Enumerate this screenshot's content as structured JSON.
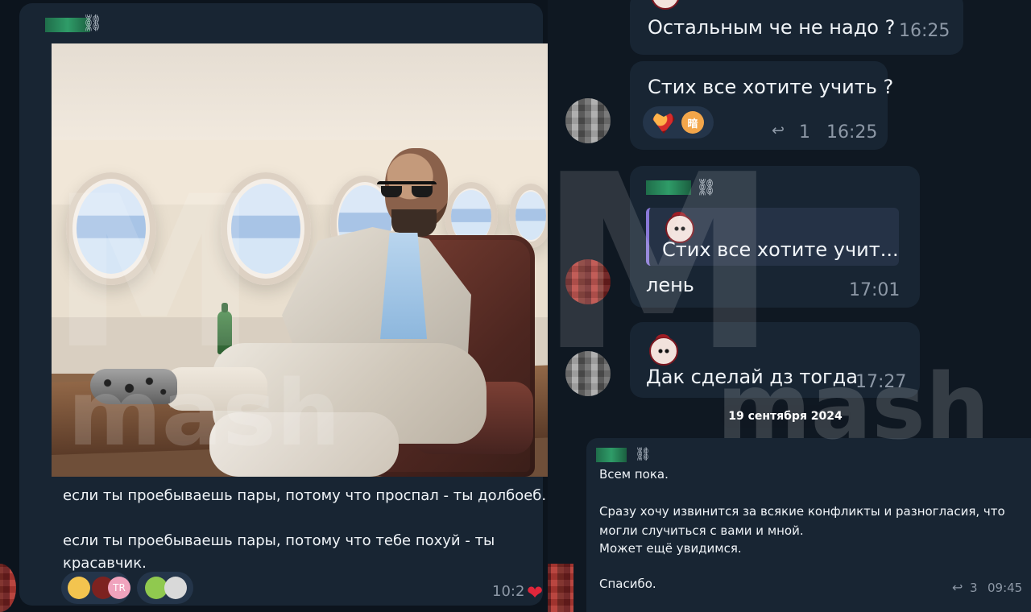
{
  "left": {
    "caption_lines": [
      "если ты проебываешь пары, потому что проспал - ты долбоеб.",
      "",
      "если ты проебываешь пары, потому что тебе похуй - ты",
      "красавчик."
    ],
    "time": "10:2",
    "reactions": [
      "thumbs-up",
      "devil",
      "tr-badge",
      "sick-face",
      "sticker"
    ],
    "tr_badge_text": "TR"
  },
  "right": {
    "messages": [
      {
        "text": "Остальным че не надо ?",
        "time": "16:25"
      },
      {
        "text": "Стих все хотите учить ?",
        "time": "16:25",
        "reply_count": "1",
        "reaction_badge": "暗"
      },
      {
        "reply_preview": "Стих все хотите учит...",
        "text": "лень",
        "time": "17:01"
      },
      {
        "text": "Дак сделай дз тогда",
        "time": "17:27"
      }
    ],
    "date_separator": "19 сентября 2024",
    "final_message": {
      "lines": [
        "Всем пока.",
        "",
        "Сразу хочу извинится за всякие конфликты и разногласия, что",
        "могли случиться с вами и мной.",
        "Может ещё увидимся.",
        "",
        "Спасибо."
      ],
      "reply_count": "3",
      "time": "09:45"
    }
  },
  "watermark": {
    "mash_text": "mash",
    "logo_text": "mash"
  },
  "colors": {
    "background": "#0e1621",
    "bubble": "#182533",
    "accent": "#8a79d8",
    "text": "#f0f4f8",
    "muted": "#8d98a6"
  }
}
